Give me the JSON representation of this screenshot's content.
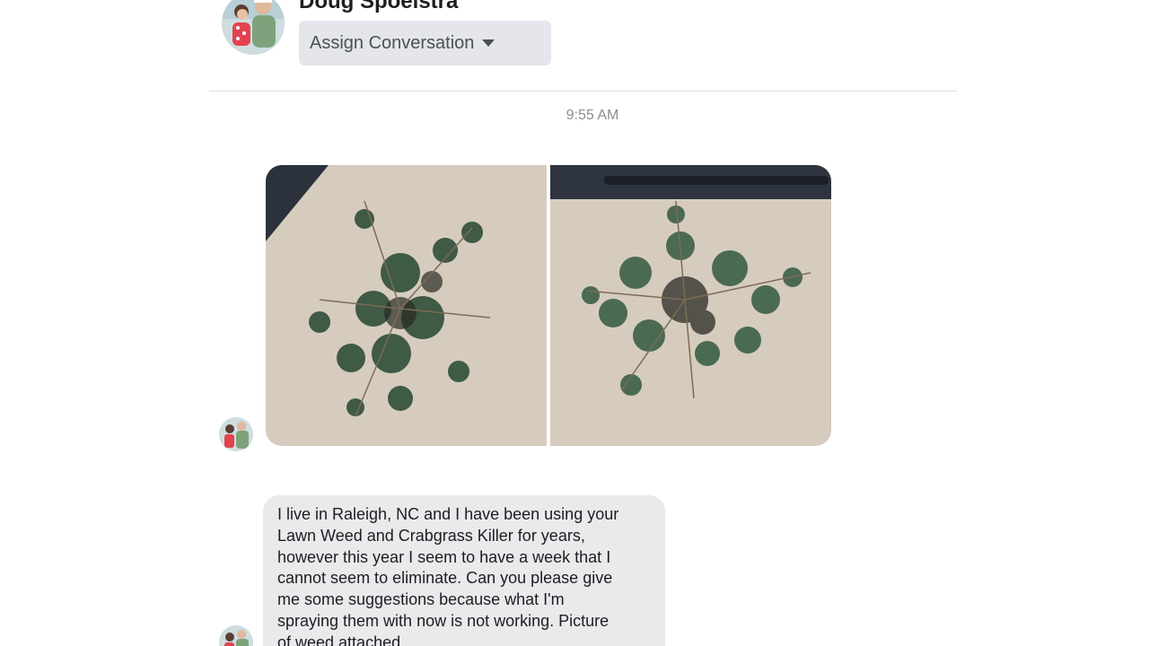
{
  "conversation": {
    "contact_name": "Doug Spoelstra",
    "assign_button_label": "Assign Conversation",
    "timestamp": "9:55 AM"
  },
  "attachments": [
    {
      "icon": "weed-photo"
    },
    {
      "icon": "weed-photo"
    }
  ],
  "messages": [
    {
      "text": "I live in Raleigh, NC and I have been using your\nLawn Weed and Crabgrass Killer for years,\nhowever this year I seem to have a week that I\ncannot seem to eliminate.  Can you please give\nme some suggestions because what I'm\nspraying them with now is not working.  Picture\nof weed attached."
    }
  ],
  "colors": {
    "bubble": "#e9eaec",
    "button": "#e4e6eb",
    "timestamp": "#8a8d91"
  }
}
